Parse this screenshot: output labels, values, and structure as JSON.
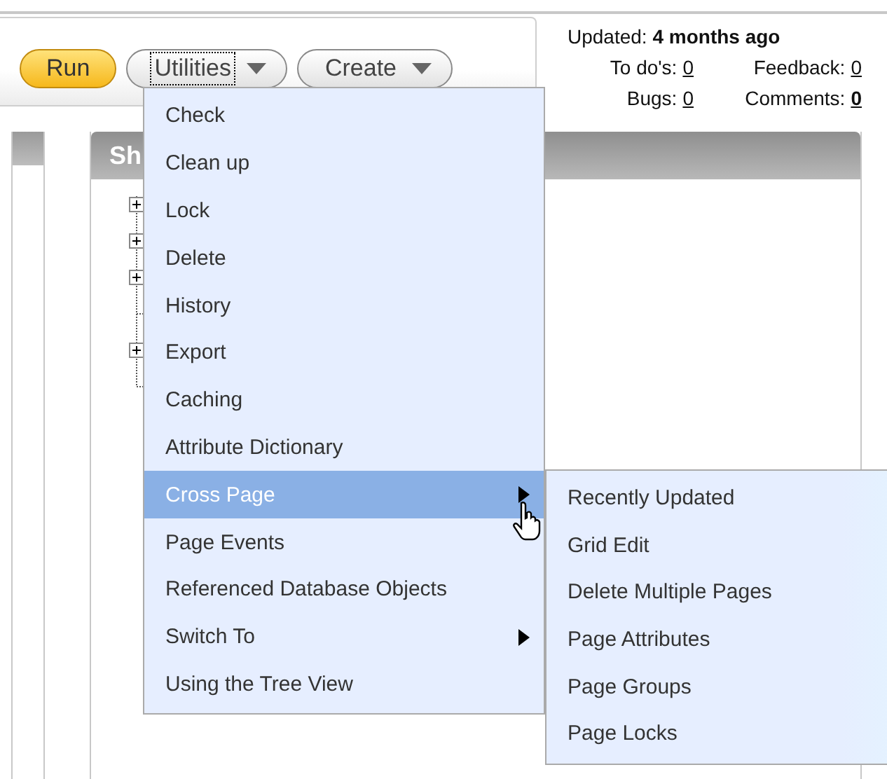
{
  "toolbar": {
    "buttons": [
      {
        "label": "Run",
        "kind": "primary",
        "focused": false
      },
      {
        "label": "Utilities",
        "kind": "dropdown",
        "focused": true
      },
      {
        "label": "Create",
        "kind": "dropdown",
        "focused": false
      }
    ]
  },
  "info": {
    "updated": "Updated: **4 months ago**",
    "stats": [
      {
        "label": "To do's:",
        "value": "0",
        "emphasized": false
      },
      {
        "label": "Feedback:",
        "value": "0",
        "emphasized": false
      },
      {
        "label": "Bugs:",
        "value": "0",
        "emphasized": false
      },
      {
        "label": "Comments:",
        "value": "0",
        "emphasized": true
      }
    ]
  },
  "panel": {
    "title": "Sh",
    "tree": [
      {
        "expanded": false,
        "kind": "folder"
      },
      {
        "expanded": false,
        "kind": "folder"
      },
      {
        "expanded": false,
        "kind": "folder"
      },
      {
        "kind": "leaf"
      },
      {
        "expanded": false,
        "kind": "folder"
      },
      {
        "kind": "leaf"
      }
    ]
  },
  "menu": {
    "items": [
      {
        "label": "Check",
        "kind": "item",
        "selected": false
      },
      {
        "label": "Clean up",
        "kind": "item",
        "selected": false
      },
      {
        "label": "Lock",
        "kind": "item",
        "selected": false
      },
      {
        "label": "Delete",
        "kind": "item",
        "selected": false
      },
      {
        "label": "History",
        "kind": "item",
        "selected": false
      },
      {
        "label": "Export",
        "kind": "item",
        "selected": false
      },
      {
        "label": "Caching",
        "kind": "item",
        "selected": false
      },
      {
        "label": "Attribute Dictionary",
        "kind": "item",
        "selected": false
      },
      {
        "label": "Cross Page",
        "kind": "submenu",
        "selected": true
      },
      {
        "label": "Page Events",
        "kind": "item",
        "selected": false
      },
      {
        "label": "Referenced Database Objects",
        "kind": "item",
        "selected": false
      },
      {
        "label": "Switch To",
        "kind": "submenu",
        "selected": false
      },
      {
        "label": "Using the Tree View",
        "kind": "item",
        "selected": false
      }
    ]
  },
  "submenu": {
    "items": [
      {
        "label": "Recently Updated",
        "selected": false
      },
      {
        "label": "Grid Edit",
        "selected": false
      },
      {
        "label": "Delete Multiple Pages",
        "selected": false
      },
      {
        "label": "Page Attributes",
        "selected": false
      },
      {
        "label": "Page Groups",
        "selected": false
      },
      {
        "label": "Page Locks",
        "selected": false
      }
    ]
  }
}
